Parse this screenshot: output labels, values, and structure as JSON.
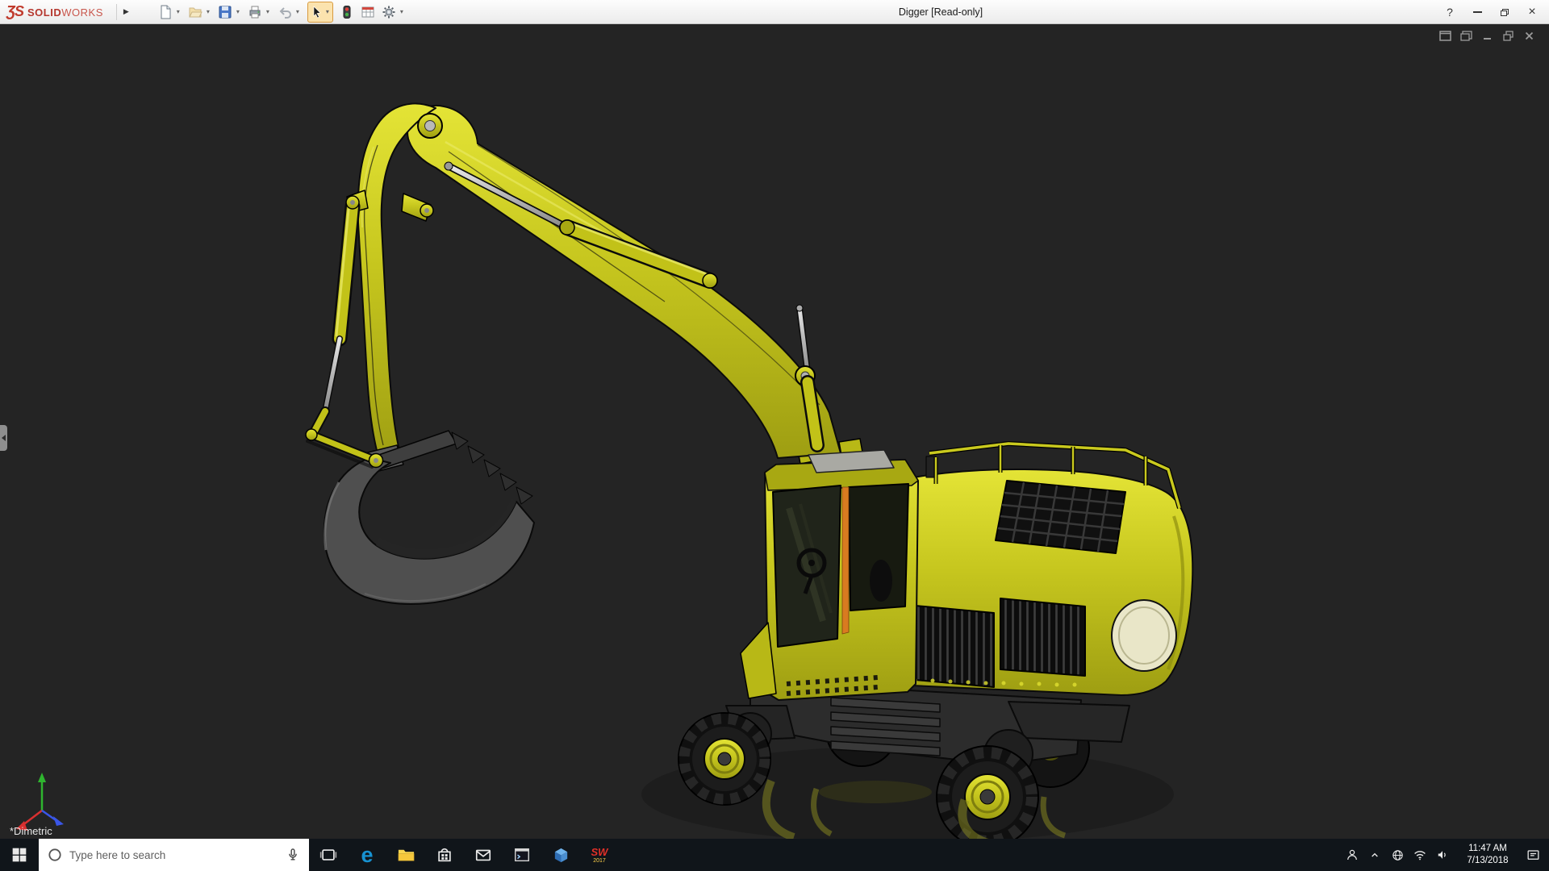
{
  "window": {
    "brand_logo_glyph": "ƷS",
    "brand_bold": "SOLID",
    "brand_light": "WORKS",
    "flyout_arrow": "▶",
    "title": "Digger [Read-only]",
    "help_glyph": "?",
    "close_glyph": "×"
  },
  "toolbar": {
    "dropdown_glyph": "▾",
    "items": [
      "new-document",
      "open",
      "save",
      "print",
      "undo",
      "select",
      "rebuild",
      "design-table",
      "options"
    ],
    "active_tool": "select"
  },
  "viewport": {
    "view_orientation_label": "*Dimetric",
    "background_color": "#242424",
    "model_color": "#c9c91e",
    "triad_axis_colors": {
      "x": "#d83030",
      "y": "#2fb52f",
      "z": "#3a56e8"
    }
  },
  "taskbar": {
    "search_placeholder": "Type here to search",
    "edge_glyph": "e",
    "sw_badge_top": "SW",
    "sw_badge_year": "2017",
    "clock_time": "11:47 AM",
    "clock_date": "7/13/2018",
    "app_icons": [
      "start",
      "search",
      "task-view",
      "edge",
      "file-explorer",
      "store",
      "mail",
      "console",
      "3d-viewer",
      "solidworks"
    ],
    "tray_icons": [
      "people",
      "hidden-icons-chevron",
      "network",
      "wifi",
      "volume",
      "action-center"
    ]
  },
  "colors": {
    "titlebar_bg": "#f1f1f1",
    "taskbar_bg": "#10151a",
    "brand_red": "#b5372e",
    "active_tool_highlight": "#fbe3ae",
    "accent_orange": "#d97b20"
  }
}
